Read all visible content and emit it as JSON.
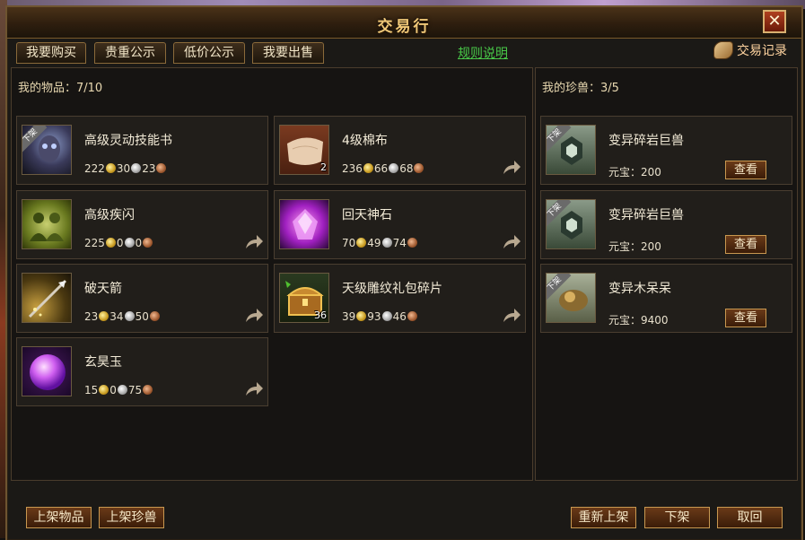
{
  "window": {
    "title": "交易行",
    "close_label": "✕"
  },
  "tabs": [
    {
      "label": "我要购买"
    },
    {
      "label": "贵重公示"
    },
    {
      "label": "低价公示"
    },
    {
      "label": "我要出售"
    }
  ],
  "rules_link": "规则说明",
  "trade_record": "交易记录",
  "items_panel": {
    "header": "我的物品：7/10",
    "items": [
      {
        "name": "高级灵动技能书",
        "gold": "222",
        "silver": "30",
        "copper": "23",
        "off_shelf": "下架",
        "icon": "skill-book-icon"
      },
      {
        "name": "4级棉布",
        "gold": "236",
        "silver": "66",
        "copper": "68",
        "qty": "2",
        "icon": "cotton-cloth-icon"
      },
      {
        "name": "高级疾闪",
        "gold": "225",
        "silver": "0",
        "copper": "0",
        "icon": "swift-dodge-icon"
      },
      {
        "name": "回天神石",
        "gold": "70",
        "silver": "49",
        "copper": "74",
        "icon": "divine-stone-icon"
      },
      {
        "name": "破天箭",
        "gold": "23",
        "silver": "34",
        "copper": "50",
        "icon": "arrow-item-icon"
      },
      {
        "name": "天级雕纹礼包碎片",
        "gold": "39",
        "silver": "93",
        "copper": "46",
        "qty": "36",
        "icon": "gift-chest-icon"
      },
      {
        "name": "玄昊玉",
        "gold": "15",
        "silver": "0",
        "copper": "75",
        "icon": "jade-orb-icon"
      }
    ]
  },
  "pets_panel": {
    "header": "我的珍兽：3/5",
    "currency_label": "元宝：",
    "view_label": "查看",
    "pets": [
      {
        "name": "变异碎岩巨兽",
        "price": "200",
        "off_shelf": "下架"
      },
      {
        "name": "变异碎岩巨兽",
        "price": "200",
        "off_shelf": "下架"
      },
      {
        "name": "变异木呆呆",
        "price": "9400",
        "off_shelf": "下架"
      }
    ]
  },
  "bottom": {
    "list_item": "上架物品",
    "list_pet": "上架珍兽",
    "relist": "重新上架",
    "delist": "下架",
    "cancel": "取回"
  }
}
